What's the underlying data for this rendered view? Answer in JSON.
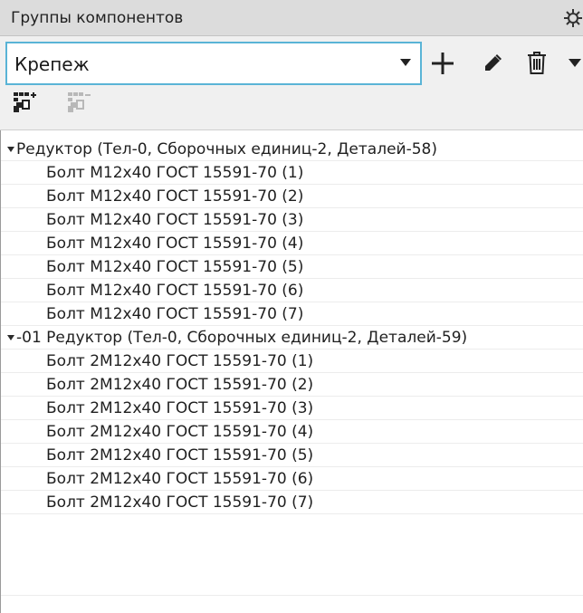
{
  "panel": {
    "title": "Группы компонентов",
    "settings_icon": "gear-icon"
  },
  "toolbar": {
    "group_select": {
      "value": "Крепеж"
    },
    "buttons": {
      "add": "plus-icon",
      "edit": "pencil-icon",
      "delete": "trash-icon",
      "more": "dropdown-arrow-icon",
      "add_to_group": "add-components-to-group-icon",
      "remove_from_group": "remove-components-from-group-icon"
    }
  },
  "tree": {
    "groups": [
      {
        "label": "Редуктор (Тел-0, Сборочных единиц-2, Деталей-58)",
        "expanded": true,
        "items": [
          "Болт М12х40 ГОСТ 15591-70 (1)",
          "Болт М12х40 ГОСТ 15591-70 (2)",
          "Болт М12х40 ГОСТ 15591-70 (3)",
          "Болт М12х40 ГОСТ 15591-70 (4)",
          "Болт М12х40 ГОСТ 15591-70 (5)",
          "Болт М12х40 ГОСТ 15591-70 (6)",
          "Болт М12х40 ГОСТ 15591-70 (7)"
        ]
      },
      {
        "label": "-01 Редуктор (Тел-0, Сборочных единиц-2, Деталей-59)",
        "expanded": true,
        "items": [
          "Болт 2М12х40 ГОСТ 15591-70 (1)",
          "Болт 2М12х40 ГОСТ 15591-70 (2)",
          "Болт 2М12х40 ГОСТ 15591-70 (3)",
          "Болт 2М12х40 ГОСТ 15591-70 (4)",
          "Болт 2М12х40 ГОСТ 15591-70 (5)",
          "Болт 2М12х40 ГОСТ 15591-70 (6)",
          "Болт 2М12х40 ГОСТ 15591-70 (7)"
        ]
      }
    ]
  },
  "colors": {
    "title_bar": "#dcdcdc",
    "toolbar": "#f0f0f0",
    "combo_focus_border": "#5ab4d6",
    "icon": "#222222",
    "icon_disabled": "#b0b0b0"
  }
}
